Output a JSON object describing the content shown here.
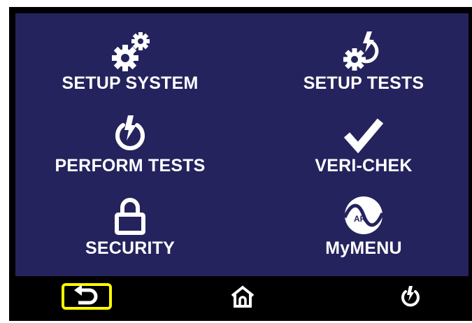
{
  "menu": {
    "items": [
      {
        "label": "SETUP SYSTEM",
        "icon": "gears-icon"
      },
      {
        "label": "SETUP TESTS",
        "icon": "gear-power-icon"
      },
      {
        "label": "PERFORM TESTS",
        "icon": "power-bolt-icon"
      },
      {
        "label": "VERI-CHEK",
        "icon": "checkmark-icon"
      },
      {
        "label": "SECURITY",
        "icon": "padlock-icon"
      },
      {
        "label": "MyMENU",
        "icon": "ar-logo-icon",
        "logo_text": "AR"
      }
    ]
  },
  "navbar": {
    "buttons": [
      {
        "name": "back",
        "icon": "back-arrow-icon",
        "highlighted": true,
        "highlight_color": "#ffff00"
      },
      {
        "name": "home",
        "icon": "home-icon"
      },
      {
        "name": "power",
        "icon": "power-icon"
      }
    ]
  },
  "colors": {
    "screen_background": "#24235d",
    "bezel": "#000000",
    "text": "#ffffff",
    "highlight": "#ffff00"
  }
}
